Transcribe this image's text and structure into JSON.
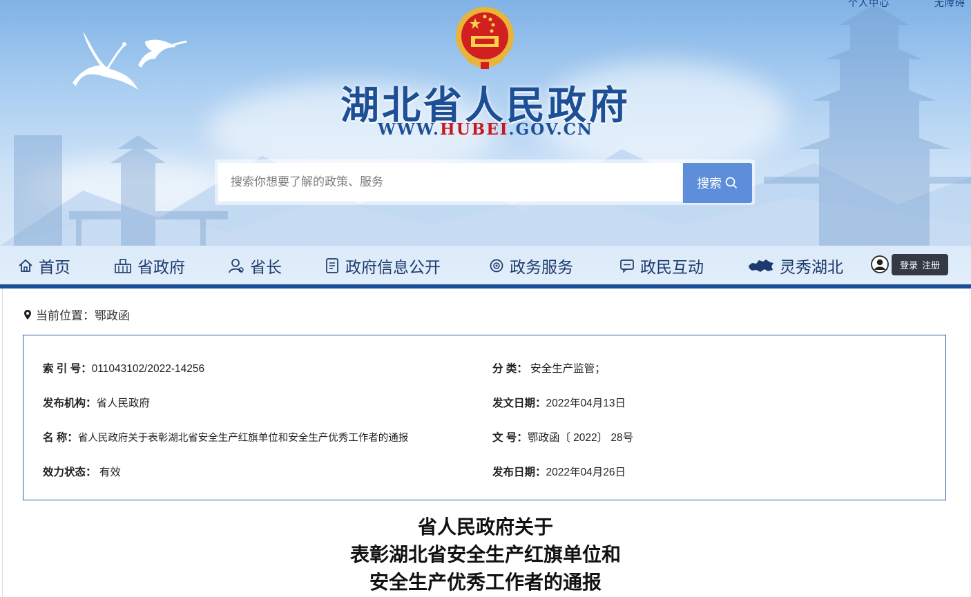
{
  "header": {
    "top_links": [
      "个人中心",
      "无障碍"
    ],
    "site_title": "湖北省人民政府",
    "site_url_prefix": "WWW.",
    "site_url_highlight": "HUBEI",
    "site_url_suffix": ".GOV.CN",
    "search": {
      "placeholder": "搜索你想要了解的政策、服务",
      "button_label": "搜索"
    }
  },
  "nav": {
    "items": [
      {
        "label": "首页",
        "icon": "home-icon"
      },
      {
        "label": "省政府",
        "icon": "building-icon"
      },
      {
        "label": "省长",
        "icon": "person-icon"
      },
      {
        "label": "政府信息公开",
        "icon": "document-icon"
      },
      {
        "label": "政务服务",
        "icon": "service-icon"
      },
      {
        "label": "政民互动",
        "icon": "chat-icon"
      },
      {
        "label": "灵秀湖北",
        "icon": "map-icon"
      }
    ],
    "login_label": "登录",
    "register_label": "注册"
  },
  "breadcrumb": {
    "prefix": "当前位置：",
    "current": "鄂政函"
  },
  "info": {
    "index_key": "索 引 号：",
    "index_value": "011043102/2022-14256",
    "category_key": "分 类：",
    "category_value": "安全生产监管；",
    "publisher_key": "发布机构：",
    "publisher_value": "省人民政府",
    "issue_date_key": "发文日期：",
    "issue_date_value": "2022年04月13日",
    "name_key": "名 称：",
    "name_value": "省人民政府关于表彰湖北省安全生产红旗单位和安全生产优秀工作者的通报",
    "doc_no_key": "文 号：",
    "doc_no_value": "鄂政函〔 2022〕 28号",
    "status_key": "效力状态：",
    "status_value": "有效",
    "publish_date_key": "发布日期：",
    "publish_date_value": "2022年04月26日"
  },
  "document": {
    "title_lines": [
      "省人民政府关于",
      "表彰湖北省安全生产红旗单位和",
      "安全生产优秀工作者的通报"
    ]
  },
  "colors": {
    "title_blue": "#1d4f96",
    "url_red": "#c9161d",
    "nav_bar": "#1a4e99",
    "search_button": "#5e8ed9",
    "box_border": "#2d5aa7"
  }
}
